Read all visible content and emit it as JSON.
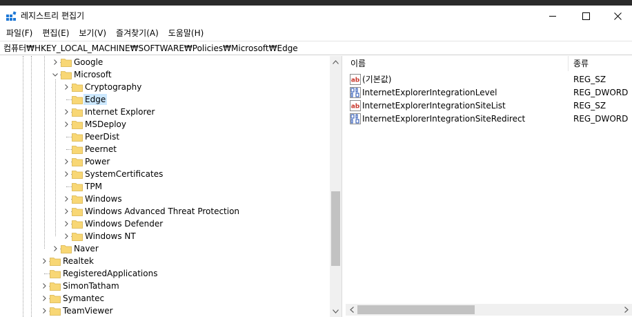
{
  "window": {
    "title": "레지스트리 편집기",
    "icons": {
      "app": "registry-editor-icon",
      "minimize": "minimize-icon",
      "maximize": "maximize-icon",
      "close": "close-icon"
    }
  },
  "menu": {
    "file": "파일(F)",
    "edit": "편집(E)",
    "view": "보기(V)",
    "favorites": "즐겨찾기(A)",
    "help": "도움말(H)"
  },
  "address": {
    "path": "컴퓨터₩HKEY_LOCAL_MACHINE₩SOFTWARE₩Policies₩Microsoft₩Edge"
  },
  "tree": {
    "nodes": [
      {
        "label": "Google",
        "level": 1,
        "expander": "collapsed"
      },
      {
        "label": "Microsoft",
        "level": 1,
        "expander": "expanded"
      },
      {
        "label": "Cryptography",
        "level": 2,
        "expander": "collapsed"
      },
      {
        "label": "Edge",
        "level": 2,
        "expander": "none",
        "selected": true
      },
      {
        "label": "Internet Explorer",
        "level": 2,
        "expander": "collapsed"
      },
      {
        "label": "MSDeploy",
        "level": 2,
        "expander": "collapsed"
      },
      {
        "label": "PeerDist",
        "level": 2,
        "expander": "none"
      },
      {
        "label": "Peernet",
        "level": 2,
        "expander": "none"
      },
      {
        "label": "Power",
        "level": 2,
        "expander": "collapsed"
      },
      {
        "label": "SystemCertificates",
        "level": 2,
        "expander": "collapsed"
      },
      {
        "label": "TPM",
        "level": 2,
        "expander": "none"
      },
      {
        "label": "Windows",
        "level": 2,
        "expander": "collapsed"
      },
      {
        "label": "Windows Advanced Threat Protection",
        "level": 2,
        "expander": "collapsed"
      },
      {
        "label": "Windows Defender",
        "level": 2,
        "expander": "collapsed"
      },
      {
        "label": "Windows NT",
        "level": 2,
        "expander": "collapsed"
      },
      {
        "label": "Naver",
        "level": 1,
        "expander": "collapsed"
      },
      {
        "label": "Realtek",
        "level": 0,
        "expander": "collapsed"
      },
      {
        "label": "RegisteredApplications",
        "level": 0,
        "expander": "none"
      },
      {
        "label": "SimonTatham",
        "level": 0,
        "expander": "collapsed"
      },
      {
        "label": "Symantec",
        "level": 0,
        "expander": "collapsed"
      },
      {
        "label": "TeamViewer",
        "level": 0,
        "expander": "collapsed"
      }
    ],
    "scroll_fraction": 0.76
  },
  "values": {
    "columns": {
      "name": "이름",
      "type": "종류"
    },
    "rows": [
      {
        "name": "(기본값)",
        "type": "REG_SZ",
        "icon": "string-value-icon"
      },
      {
        "name": "InternetExplorerIntegrationLevel",
        "type": "REG_DWORD",
        "icon": "binary-value-icon"
      },
      {
        "name": "InternetExplorerIntegrationSiteList",
        "type": "REG_SZ",
        "icon": "string-value-icon"
      },
      {
        "name": "InternetExplorerIntegrationSiteRedirect",
        "type": "REG_DWORD",
        "icon": "binary-value-icon"
      }
    ],
    "hscroll_fraction": 0.0
  },
  "colors": {
    "folder": "#f8d775",
    "selection": "#cce8ff",
    "string_icon": "#c8362b",
    "binary_icon": "#2b57b5"
  }
}
